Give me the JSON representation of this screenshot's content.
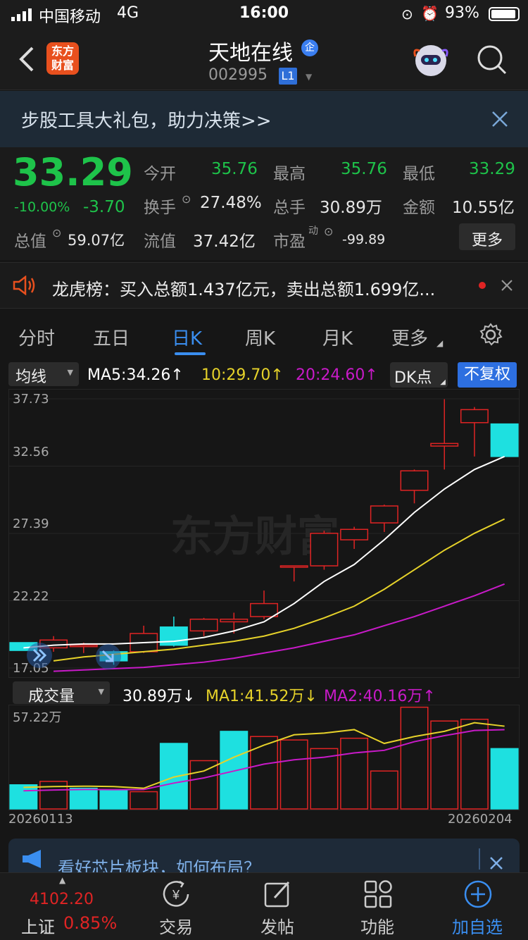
{
  "status": {
    "carrier": "中国移动",
    "network": "4G",
    "time": "16:00",
    "battery": "93%"
  },
  "nav": {
    "logo_text": "东方财富",
    "title": "天地在线",
    "badge": "企",
    "code": "002995",
    "level": "L1"
  },
  "banner": {
    "text": "步股工具大礼包，助力决策>>"
  },
  "quote": {
    "price": "33.29",
    "change_pct": "-10.00%",
    "change": "-3.70",
    "open_label": "今开",
    "open": "35.76",
    "high_label": "最高",
    "high": "35.76",
    "low_label": "最低",
    "low": "33.29",
    "turnover_label": "换手",
    "turnover": "27.48%",
    "volume_label": "总手",
    "volume": "30.89万",
    "amount_label": "金额",
    "amount": "10.55亿",
    "mktcap_label": "总值",
    "mktcap": "59.07亿",
    "float_label": "流值",
    "float": "37.42亿",
    "pe_label": "市盈",
    "pe_sup": "动",
    "pe": "-99.89",
    "more_label": "更多"
  },
  "lhb": {
    "text": "龙虎榜：买入总额1.437亿元，卖出总额1.699亿..."
  },
  "tabs": {
    "t1": "分时",
    "t2": "五日",
    "t3": "日K",
    "t4": "周K",
    "t5": "月K",
    "t6": "更多"
  },
  "ma": {
    "selector": "均线",
    "ma5": "MA5:34.26↑",
    "ma10": "10:29.70↑",
    "ma20": "20:24.60↑",
    "dk": "DK点",
    "fq": "不复权"
  },
  "vol": {
    "selector": "成交量",
    "cur": "30.89万↓",
    "ma1": "MA1:41.52万↓",
    "ma2": "MA2:40.16万↑"
  },
  "dates": {
    "start": "20260113",
    "end": "20260204"
  },
  "watermark": "东方财富",
  "news": {
    "text": "看好芯片板块，如何布局？"
  },
  "bottom": {
    "index_value": "4102.20",
    "index_name": "上证",
    "index_pct": "0.85%",
    "trade": "交易",
    "post": "发帖",
    "func": "功能",
    "add": "加自选"
  },
  "colors": {
    "up": "#e02424",
    "down": "#1ee0e0",
    "green": "#1ec34a",
    "ma5": "#ffffff",
    "ma10": "#e6d22a",
    "ma20": "#c81ac8",
    "accent": "#3a8ef0"
  },
  "chart_data": [
    {
      "type": "candlestick",
      "y_ticks": [
        "37.73",
        "32.56",
        "27.39",
        "22.22",
        "17.05"
      ],
      "ylim": [
        17.05,
        37.73
      ],
      "candles": [
        {
          "o": 19.0,
          "c": 18.4,
          "h": 19.0,
          "l": 18.4
        },
        {
          "o": 18.6,
          "c": 19.2,
          "h": 19.5,
          "l": 18.3
        },
        {
          "o": 18.7,
          "c": 18.8,
          "h": 19.0,
          "l": 18.2
        },
        {
          "o": 18.3,
          "c": 17.6,
          "h": 18.4,
          "l": 17.3
        },
        {
          "o": 18.3,
          "c": 19.7,
          "h": 20.3,
          "l": 18.2
        },
        {
          "o": 20.2,
          "c": 18.8,
          "h": 21.0,
          "l": 18.7
        },
        {
          "o": 19.9,
          "c": 20.8,
          "h": 20.9,
          "l": 19.5
        },
        {
          "o": 20.6,
          "c": 20.8,
          "h": 21.3,
          "l": 19.7
        },
        {
          "o": 21.0,
          "c": 22.0,
          "h": 23.0,
          "l": 20.8
        },
        {
          "o": 24.9,
          "c": 24.9,
          "h": 24.9,
          "l": 23.7
        },
        {
          "o": 24.9,
          "c": 27.4,
          "h": 27.6,
          "l": 24.6
        },
        {
          "o": 26.9,
          "c": 27.7,
          "h": 27.9,
          "l": 26.2
        },
        {
          "o": 28.2,
          "c": 29.5,
          "h": 29.6,
          "l": 27.5
        },
        {
          "o": 30.7,
          "c": 32.2,
          "h": 32.3,
          "l": 29.7
        },
        {
          "o": 34.1,
          "c": 34.3,
          "h": 37.7,
          "l": 32.3
        },
        {
          "o": 35.9,
          "c": 36.9,
          "h": 37.1,
          "l": 33.3
        },
        {
          "o": 35.8,
          "c": 33.3,
          "h": 35.8,
          "l": 33.3
        }
      ],
      "ma5": [
        18.6,
        18.8,
        18.9,
        18.9,
        19.0,
        19.1,
        19.4,
        19.9,
        20.6,
        22.0,
        23.7,
        25.0,
        26.9,
        29.0,
        30.8,
        32.3,
        33.3
      ],
      "ma10": [
        17.6,
        17.9,
        18.1,
        18.3,
        18.5,
        18.8,
        19.1,
        19.5,
        20.1,
        20.9,
        21.8,
        23.1,
        24.6,
        26.1,
        27.4,
        28.5
      ],
      "ma20": [
        16.8,
        16.9,
        17.0,
        17.1,
        17.3,
        17.5,
        17.8,
        18.2,
        18.6,
        19.1,
        19.6,
        20.3,
        21.0,
        21.8,
        22.6,
        23.5
      ]
    },
    {
      "type": "bar",
      "y_ticks": [
        "57.22万"
      ],
      "ylim": [
        0,
        57.22
      ],
      "values": [
        14.0,
        16.0,
        12.0,
        11.0,
        10.0,
        38.0,
        28.0,
        45.0,
        42.0,
        40.0,
        35.0,
        41.0,
        22.0,
        59.0,
        51.0,
        52.0,
        35.0
      ],
      "up": [
        false,
        true,
        false,
        false,
        true,
        false,
        true,
        false,
        true,
        true,
        true,
        true,
        true,
        true,
        true,
        true,
        false
      ],
      "ma1": [
        12.5,
        13.0,
        13.2,
        13.0,
        12.0,
        18.5,
        22.0,
        30.0,
        37.0,
        43.0,
        44.0,
        46.0,
        38.0,
        42.0,
        45.0,
        50.0,
        48.0
      ],
      "ma2": [
        10.5,
        11.0,
        11.3,
        11.2,
        11.3,
        15.0,
        18.0,
        22.0,
        26.0,
        28.5,
        30.0,
        32.5,
        34.0,
        39.0,
        42.5,
        45.5,
        46.0
      ]
    }
  ]
}
